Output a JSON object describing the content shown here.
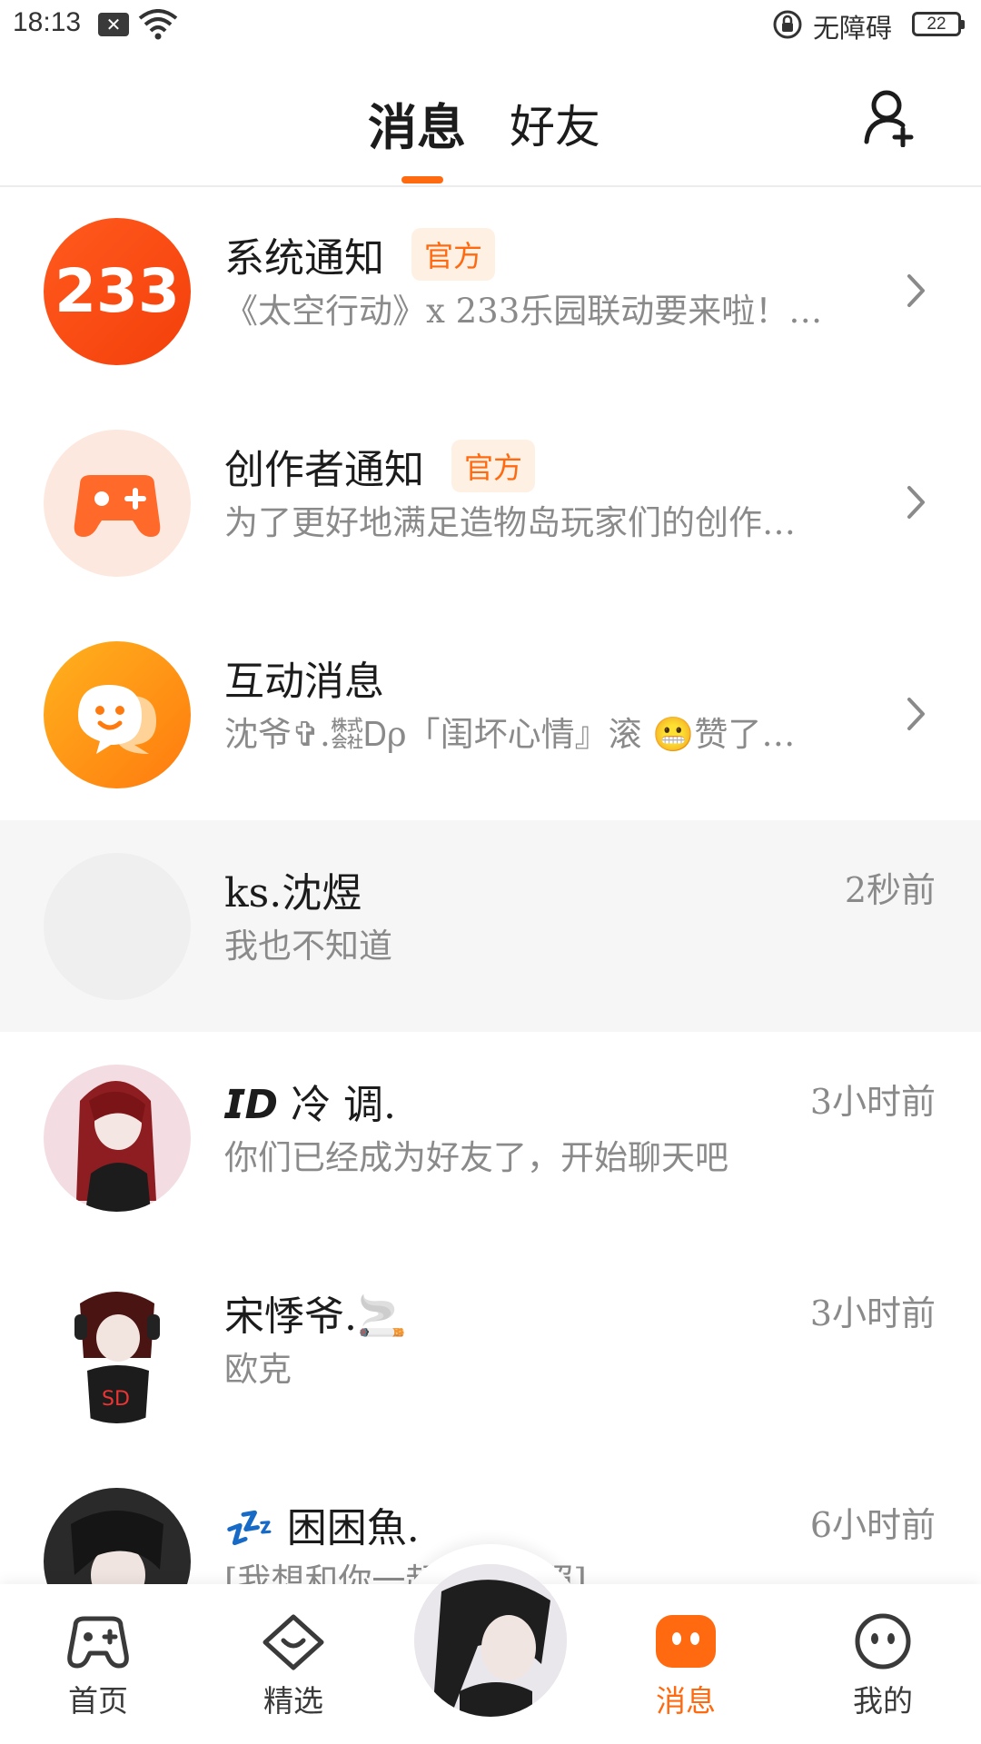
{
  "status_bar": {
    "time": "18:13",
    "notification_icon": "x-box-icon",
    "accessibility_label": "无障碍",
    "battery": "22"
  },
  "header": {
    "tabs": [
      {
        "label": "消息",
        "active": true
      },
      {
        "label": "好友",
        "active": false
      }
    ],
    "add_friend_icon": "add-user-icon",
    "accent_color": "#ff6a10"
  },
  "conversations": [
    {
      "title": "系统通知",
      "badge": "官方",
      "preview": "《太空行动》x 233乐园联动要来啦！…",
      "avatar_text": "233",
      "type": "official"
    },
    {
      "title": "创作者通知",
      "badge": "官方",
      "preview": "为了更好地满足造物岛玩家们的创作…",
      "type": "official"
    },
    {
      "title": "互动消息",
      "preview": "沈爷✞.㍿Ꭰρ「闺坏心情』滚 😬赞了…",
      "type": "official"
    },
    {
      "title": "ks.沈煜",
      "preview": "我也不知道",
      "time": "2秒前"
    },
    {
      "title": "𝙄𝘿  冷 调.",
      "preview": "你们已经成为好友了，开始聊天吧",
      "time": "3小时前"
    },
    {
      "title": "宋悸爷.🚬",
      "preview": "欧克",
      "time": "3小时前"
    },
    {
      "title": "💤 困困魚.",
      "preview": "[我想和你一起拍张合照]",
      "time": "6小时前"
    }
  ],
  "bottom_nav": [
    {
      "label": "首页",
      "icon": "gamepad-icon"
    },
    {
      "label": "精选",
      "icon": "heart-tag-icon"
    },
    {
      "label": "消息",
      "icon": "message-icon",
      "active": true
    },
    {
      "label": "我的",
      "icon": "face-icon"
    }
  ]
}
